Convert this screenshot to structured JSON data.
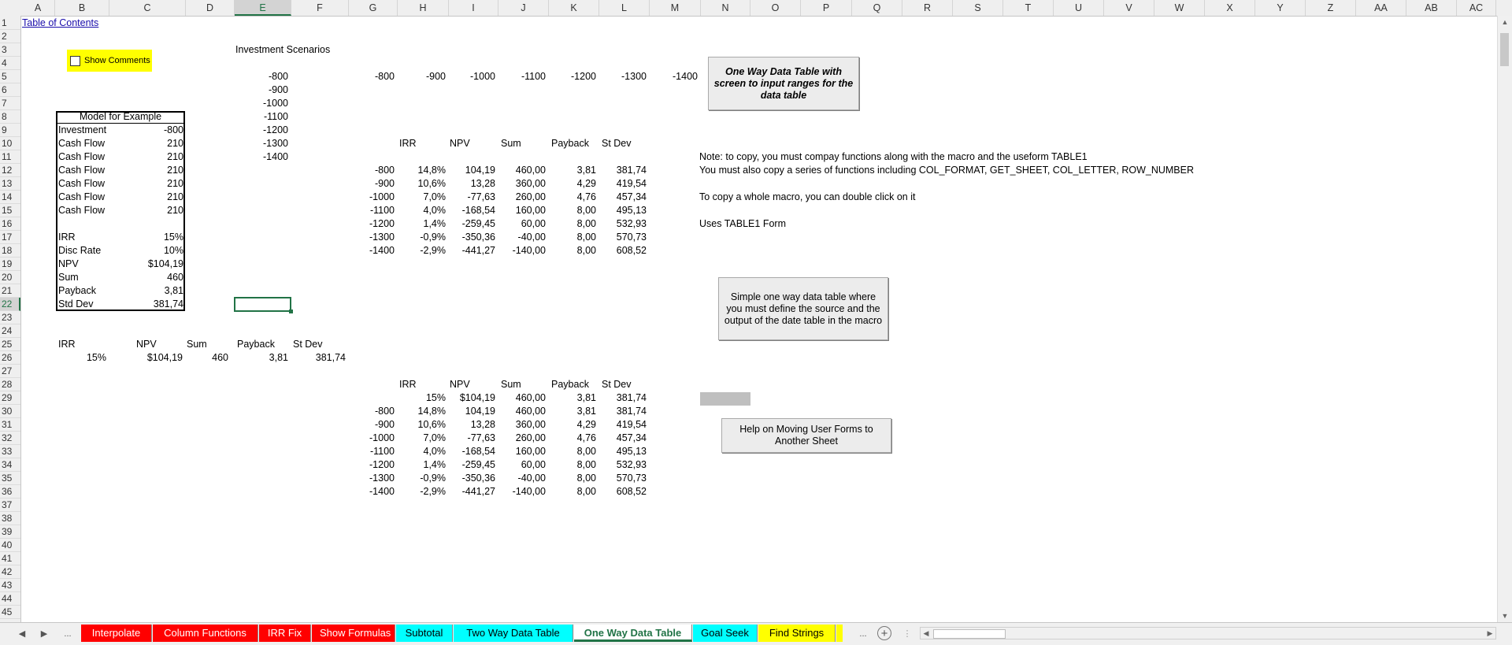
{
  "columns": [
    "A",
    "B",
    "C",
    "D",
    "E",
    "F",
    "G",
    "H",
    "I",
    "J",
    "K",
    "L",
    "M",
    "N",
    "O",
    "P",
    "Q",
    "R",
    "S",
    "T",
    "U",
    "V",
    "W",
    "X",
    "Y",
    "Z",
    "AA",
    "AB",
    "AC"
  ],
  "selected_column": "E",
  "rows": [
    1,
    2,
    3,
    4,
    5,
    6,
    7,
    8,
    9,
    10,
    11,
    12,
    13,
    14,
    15,
    16,
    17,
    18,
    19,
    20,
    21,
    22,
    23,
    24,
    25,
    26,
    27,
    28,
    29,
    30,
    31,
    32,
    33,
    34,
    35,
    36,
    37,
    38,
    39,
    40,
    41,
    42,
    43,
    44,
    45
  ],
  "selected_row": 22,
  "toc_link": "Table of Contents",
  "show_comments_label": "Show Comments",
  "investment_scenarios_title": "Investment Scenarios",
  "scenario_values": [
    "-800",
    "-900",
    "-1000",
    "-1100",
    "-1200",
    "-1300",
    "-1400"
  ],
  "model": {
    "title": "Model for Example",
    "rows": [
      {
        "label": "Investment",
        "value": "-800"
      },
      {
        "label": "Cash Flow",
        "value": "210"
      },
      {
        "label": "Cash Flow",
        "value": "210"
      },
      {
        "label": "Cash Flow",
        "value": "210"
      },
      {
        "label": "Cash Flow",
        "value": "210"
      },
      {
        "label": "Cash Flow",
        "value": "210"
      },
      {
        "label": "Cash Flow",
        "value": "210"
      },
      {
        "label": "",
        "value": ""
      },
      {
        "label": "IRR",
        "value": "15%"
      },
      {
        "label": "Disc Rate",
        "value": "10%"
      },
      {
        "label": "NPV",
        "value": "$104,19"
      },
      {
        "label": "Sum",
        "value": "460"
      },
      {
        "label": "Payback",
        "value": "3,81"
      },
      {
        "label": "Std Dev",
        "value": "381,74"
      }
    ]
  },
  "summary_headers": [
    "IRR",
    "NPV",
    "Sum",
    "Payback",
    "St Dev"
  ],
  "summary_values": [
    "15%",
    "$104,19",
    "460",
    "3,81",
    "381,74"
  ],
  "headers": [
    "IRR",
    "NPV",
    "Sum",
    "Payback",
    "St Dev"
  ],
  "table1": [
    [
      "-800",
      "14,8%",
      "104,19",
      "460,00",
      "3,81",
      "381,74"
    ],
    [
      "-900",
      "10,6%",
      "13,28",
      "360,00",
      "4,29",
      "419,54"
    ],
    [
      "-1000",
      "7,0%",
      "-77,63",
      "260,00",
      "4,76",
      "457,34"
    ],
    [
      "-1100",
      "4,0%",
      "-168,54",
      "160,00",
      "8,00",
      "495,13"
    ],
    [
      "-1200",
      "1,4%",
      "-259,45",
      "60,00",
      "8,00",
      "532,93"
    ],
    [
      "-1300",
      "-0,9%",
      "-350,36",
      "-40,00",
      "8,00",
      "570,73"
    ],
    [
      "-1400",
      "-2,9%",
      "-441,27",
      "-140,00",
      "8,00",
      "608,52"
    ]
  ],
  "table2_first": [
    "15%",
    "$104,19",
    "460,00",
    "3,81",
    "381,74"
  ],
  "table2": [
    [
      "-800",
      "14,8%",
      "104,19",
      "460,00",
      "3,81",
      "381,74"
    ],
    [
      "-900",
      "10,6%",
      "13,28",
      "360,00",
      "4,29",
      "419,54"
    ],
    [
      "-1000",
      "7,0%",
      "-77,63",
      "260,00",
      "4,76",
      "457,34"
    ],
    [
      "-1100",
      "4,0%",
      "-168,54",
      "160,00",
      "8,00",
      "495,13"
    ],
    [
      "-1200",
      "1,4%",
      "-259,45",
      "60,00",
      "8,00",
      "532,93"
    ],
    [
      "-1300",
      "-0,9%",
      "-350,36",
      "-40,00",
      "8,00",
      "570,73"
    ],
    [
      "-1400",
      "-2,9%",
      "-441,27",
      "-140,00",
      "8,00",
      "608,52"
    ]
  ],
  "notes": [
    "Note: to copy, you must compay functions along with the macro and the useform TABLE1",
    "You must also copy a series of functions including COL_FORMAT, GET_SHEET, COL_LETTER, ROW_NUMBER",
    "",
    "To copy a whole macro, you can double click on it",
    "",
    "Uses TABLE1 Form"
  ],
  "buttons": {
    "one_way_screen": "One Way Data Table with screen to input ranges for the data table",
    "simple_one_way": "Simple one way data table where you must define the source and the output of the date table in the macro",
    "help_moving": "Help on Moving User Forms to Another Sheet"
  },
  "tabs": [
    {
      "label": "Interpolate",
      "color": "#ff0000",
      "text": "#ffffff"
    },
    {
      "label": "Column Functions",
      "color": "#ff0000",
      "text": "#ffffff"
    },
    {
      "label": "IRR Fix",
      "color": "#ff0000",
      "text": "#ffffff"
    },
    {
      "label": "Show Formulas",
      "color": "#ff0000",
      "text": "#ffffff"
    },
    {
      "label": "Subtotal",
      "color": "#00ffff",
      "text": "#000000"
    },
    {
      "label": "Two Way Data Table",
      "color": "#00ffff",
      "text": "#000000"
    },
    {
      "label": "One Way Data Table",
      "color": "#ffffff",
      "text": "#217346",
      "active": true
    },
    {
      "label": "Goal Seek",
      "color": "#00ffff",
      "text": "#000000"
    },
    {
      "label": "Find Strings",
      "color": "#ffff00",
      "text": "#000000"
    }
  ],
  "ellipsis": "..."
}
